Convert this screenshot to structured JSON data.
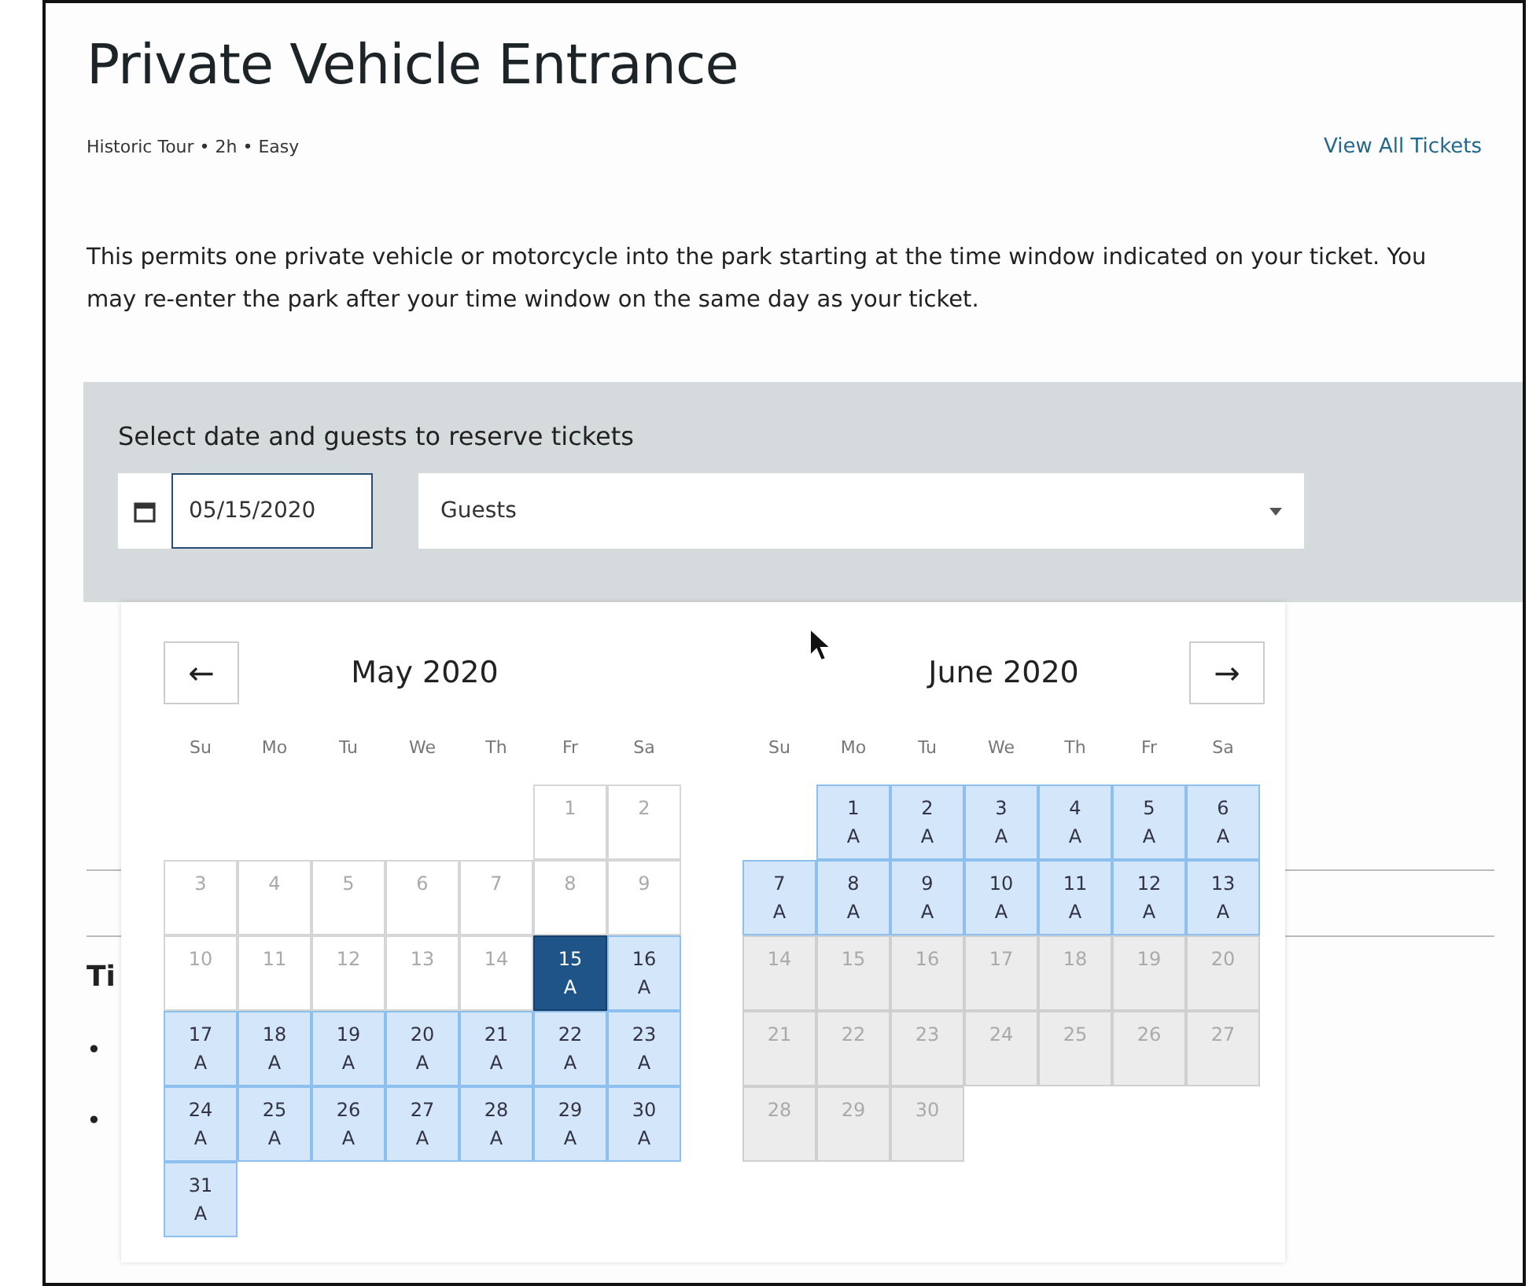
{
  "title": "Private Vehicle Entrance",
  "subtitle": "Historic Tour • 2h • Easy",
  "view_all_link": "View All Tickets",
  "description": "This permits one private vehicle or motorcycle into the park starting at the time window indicated on your ticket. You may re-enter the park after your time window on the same day as your ticket.",
  "reserve_panel": {
    "heading": "Select date and guests to reserve tickets",
    "date_value": "05/15/2020",
    "guests_placeholder": "Guests"
  },
  "behind": {
    "heading": "Ti",
    "bullets": [
      "•",
      "•"
    ]
  },
  "calendar": {
    "prev_button": "←",
    "next_button": "→",
    "months": [
      {
        "title": "May 2020",
        "weekdays": [
          "Su",
          "Mo",
          "Tu",
          "We",
          "Th",
          "Fr",
          "Sa"
        ],
        "days": [
          {
            "kind": "blank"
          },
          {
            "kind": "blank"
          },
          {
            "kind": "blank"
          },
          {
            "kind": "blank"
          },
          {
            "kind": "blank"
          },
          {
            "kind": "past",
            "day": "1",
            "selected": false
          },
          {
            "kind": "past",
            "day": "2",
            "selected": false
          },
          {
            "kind": "past",
            "day": "3",
            "selected": false
          },
          {
            "kind": "past",
            "day": "4",
            "selected": false
          },
          {
            "kind": "past",
            "day": "5",
            "selected": false
          },
          {
            "kind": "past",
            "day": "6",
            "selected": false
          },
          {
            "kind": "past",
            "day": "7",
            "selected": false
          },
          {
            "kind": "past",
            "day": "8",
            "selected": false
          },
          {
            "kind": "past",
            "day": "9",
            "selected": false
          },
          {
            "kind": "past",
            "day": "10",
            "selected": false
          },
          {
            "kind": "past",
            "day": "11",
            "selected": false
          },
          {
            "kind": "past",
            "day": "12",
            "selected": false
          },
          {
            "kind": "past",
            "day": "13",
            "selected": false
          },
          {
            "kind": "past",
            "day": "14",
            "selected": false
          },
          {
            "kind": "available",
            "day": "15",
            "status": "A",
            "selected": true
          },
          {
            "kind": "available",
            "day": "16",
            "status": "A",
            "selected": false
          },
          {
            "kind": "available",
            "day": "17",
            "status": "A",
            "selected": false
          },
          {
            "kind": "available",
            "day": "18",
            "status": "A",
            "selected": false
          },
          {
            "kind": "available",
            "day": "19",
            "status": "A",
            "selected": false
          },
          {
            "kind": "available",
            "day": "20",
            "status": "A",
            "selected": false
          },
          {
            "kind": "available",
            "day": "21",
            "status": "A",
            "selected": false
          },
          {
            "kind": "available",
            "day": "22",
            "status": "A",
            "selected": false
          },
          {
            "kind": "available",
            "day": "23",
            "status": "A",
            "selected": false
          },
          {
            "kind": "available",
            "day": "24",
            "status": "A",
            "selected": false
          },
          {
            "kind": "available",
            "day": "25",
            "status": "A",
            "selected": false
          },
          {
            "kind": "available",
            "day": "26",
            "status": "A",
            "selected": false
          },
          {
            "kind": "available",
            "day": "27",
            "status": "A",
            "selected": false
          },
          {
            "kind": "available",
            "day": "28",
            "status": "A",
            "selected": false
          },
          {
            "kind": "available",
            "day": "29",
            "status": "A",
            "selected": false
          },
          {
            "kind": "available",
            "day": "30",
            "status": "A",
            "selected": false
          },
          {
            "kind": "available",
            "day": "31",
            "status": "A",
            "selected": false
          }
        ]
      },
      {
        "title": "June 2020",
        "weekdays": [
          "Su",
          "Mo",
          "Tu",
          "We",
          "Th",
          "Fr",
          "Sa"
        ],
        "days": [
          {
            "kind": "blank"
          },
          {
            "kind": "available",
            "day": "1",
            "status": "A",
            "selected": false
          },
          {
            "kind": "available",
            "day": "2",
            "status": "A",
            "selected": false
          },
          {
            "kind": "available",
            "day": "3",
            "status": "A",
            "selected": false
          },
          {
            "kind": "available",
            "day": "4",
            "status": "A",
            "selected": false
          },
          {
            "kind": "available",
            "day": "5",
            "status": "A",
            "selected": false
          },
          {
            "kind": "available",
            "day": "6",
            "status": "A",
            "selected": false
          },
          {
            "kind": "available",
            "day": "7",
            "status": "A",
            "selected": false
          },
          {
            "kind": "available",
            "day": "8",
            "status": "A",
            "selected": false
          },
          {
            "kind": "available",
            "day": "9",
            "status": "A",
            "selected": false
          },
          {
            "kind": "available",
            "day": "10",
            "status": "A",
            "selected": false
          },
          {
            "kind": "available",
            "day": "11",
            "status": "A",
            "selected": false
          },
          {
            "kind": "available",
            "day": "12",
            "status": "A",
            "selected": false
          },
          {
            "kind": "available",
            "day": "13",
            "status": "A",
            "selected": false
          },
          {
            "kind": "closed",
            "day": "14",
            "selected": false
          },
          {
            "kind": "closed",
            "day": "15",
            "selected": false
          },
          {
            "kind": "closed",
            "day": "16",
            "selected": false
          },
          {
            "kind": "closed",
            "day": "17",
            "selected": false
          },
          {
            "kind": "closed",
            "day": "18",
            "selected": false
          },
          {
            "kind": "closed",
            "day": "19",
            "selected": false
          },
          {
            "kind": "closed",
            "day": "20",
            "selected": false
          },
          {
            "kind": "closed",
            "day": "21",
            "selected": false
          },
          {
            "kind": "closed",
            "day": "22",
            "selected": false
          },
          {
            "kind": "closed",
            "day": "23",
            "selected": false
          },
          {
            "kind": "closed",
            "day": "24",
            "selected": false
          },
          {
            "kind": "closed",
            "day": "25",
            "selected": false
          },
          {
            "kind": "closed",
            "day": "26",
            "selected": false
          },
          {
            "kind": "closed",
            "day": "27",
            "selected": false
          },
          {
            "kind": "closed",
            "day": "28",
            "selected": false
          },
          {
            "kind": "closed",
            "day": "29",
            "selected": false
          },
          {
            "kind": "closed",
            "day": "30",
            "selected": false
          }
        ]
      }
    ]
  }
}
